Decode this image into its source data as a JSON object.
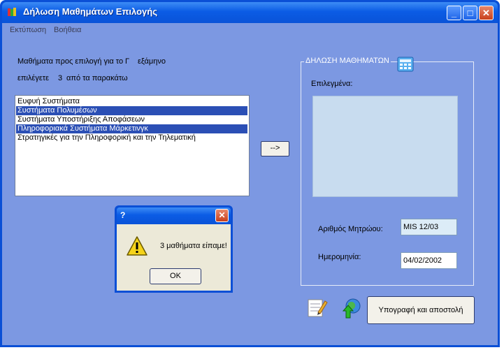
{
  "window": {
    "title": "Δήλωση Μαθημάτων Επιλογής",
    "minimize": "_",
    "maximize": "□",
    "close": "✕"
  },
  "menu": [
    "Εκτύπωση",
    "Βοήθεια"
  ],
  "intro": {
    "line1_prefix": "Μαθήματα προς επιλογή για το",
    "semester": "Γ",
    "line1_suffix": "εξάμηνο",
    "line2_prefix": "επιλέγετε",
    "count": "3",
    "line2_suffix": "από τα παρακάτω"
  },
  "courses": [
    {
      "label": "Ευφυή Συστήματα",
      "selected": false
    },
    {
      "label": "Συστήματα Πολυμέσων",
      "selected": true
    },
    {
      "label": "Συστήματα Υποστήριξης Αποφάσεων",
      "selected": false
    },
    {
      "label": "Πληροφοριακά Συστήματα Μάρκετινγκ",
      "selected": true
    },
    {
      "label": "Στρατηγικές για την Πληροφορική και την Τηλεματική",
      "selected": false
    }
  ],
  "add_button": "-->",
  "declaration": {
    "group_title": "ΔΗΛΩΣΗ ΜΑΘΗΜΑΤΩΝ",
    "selected_label": "Επιλεγμένα:",
    "registry_label": "Αριθμός Μητρώου:",
    "registry_value": "MIS 12/03",
    "date_label": "Ημερομηνία:",
    "date_value": "04/02/2002"
  },
  "sign_button": "Υπογραφή και αποστολή",
  "dialog": {
    "title": "?",
    "close": "✕",
    "message": "3  μαθήματα είπαμε!",
    "ok": "OK"
  },
  "icons": {
    "app": "books-icon",
    "declaration": "calculator-icon",
    "edit": "notepad-pencil-icon",
    "send": "globe-arrow-icon",
    "warning": "warning-icon"
  },
  "colors": {
    "client_bg": "#7c98e2",
    "selection": "#2b4fb5",
    "titlebar": "#0b5ce5"
  }
}
